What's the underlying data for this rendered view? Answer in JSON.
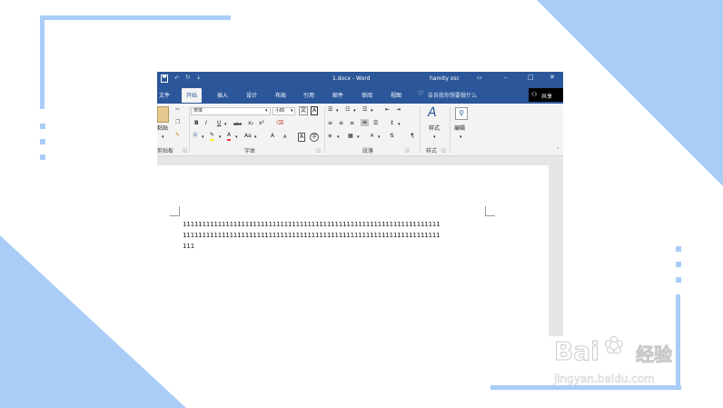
{
  "window": {
    "doc_title": "1.docx - Word",
    "user": "hamity xsc",
    "icons": [
      "save-icon",
      "undo-icon",
      "redo-icon",
      "customize-qat-icon",
      "ribbon-options-icon",
      "minimize-icon",
      "maximize-icon",
      "close-icon"
    ]
  },
  "tabs": [
    {
      "label": "文件"
    },
    {
      "label": "开始"
    },
    {
      "label": "插入"
    },
    {
      "label": "设计"
    },
    {
      "label": "布局"
    },
    {
      "label": "引用"
    },
    {
      "label": "邮件"
    },
    {
      "label": "审阅"
    },
    {
      "label": "视图"
    }
  ],
  "tellme": {
    "label": "告诉我你想要做什么"
  },
  "share": {
    "label": "共享"
  },
  "ribbon": {
    "clipboard": {
      "paste_label": "粘贴",
      "group_label": "剪贴板"
    },
    "font": {
      "font_name": "宋体",
      "font_size": "小四",
      "bold": "B",
      "italic": "I",
      "underline": "U",
      "strike": "abc",
      "subscript": "x₂",
      "superscript": "x²",
      "case": "Aa",
      "grow": "A",
      "shrink": "A",
      "group_label": "字体"
    },
    "paragraph": {
      "group_label": "段落"
    },
    "styles": {
      "button_label": "样式",
      "group_label": "样式"
    },
    "editing": {
      "button_label": "编辑"
    }
  },
  "document": {
    "lines": [
      "111111111111111111111111111111111111111111111111111111111111111111",
      "111111111111111111111111111111111111111111111111111111111111111111",
      "111"
    ]
  },
  "watermark": {
    "brand": "Bai",
    "brand2": "经验",
    "url": "jingyan.baidu.com"
  },
  "colors": {
    "accent": "#2b579a",
    "frame": "#a9cdf7"
  }
}
